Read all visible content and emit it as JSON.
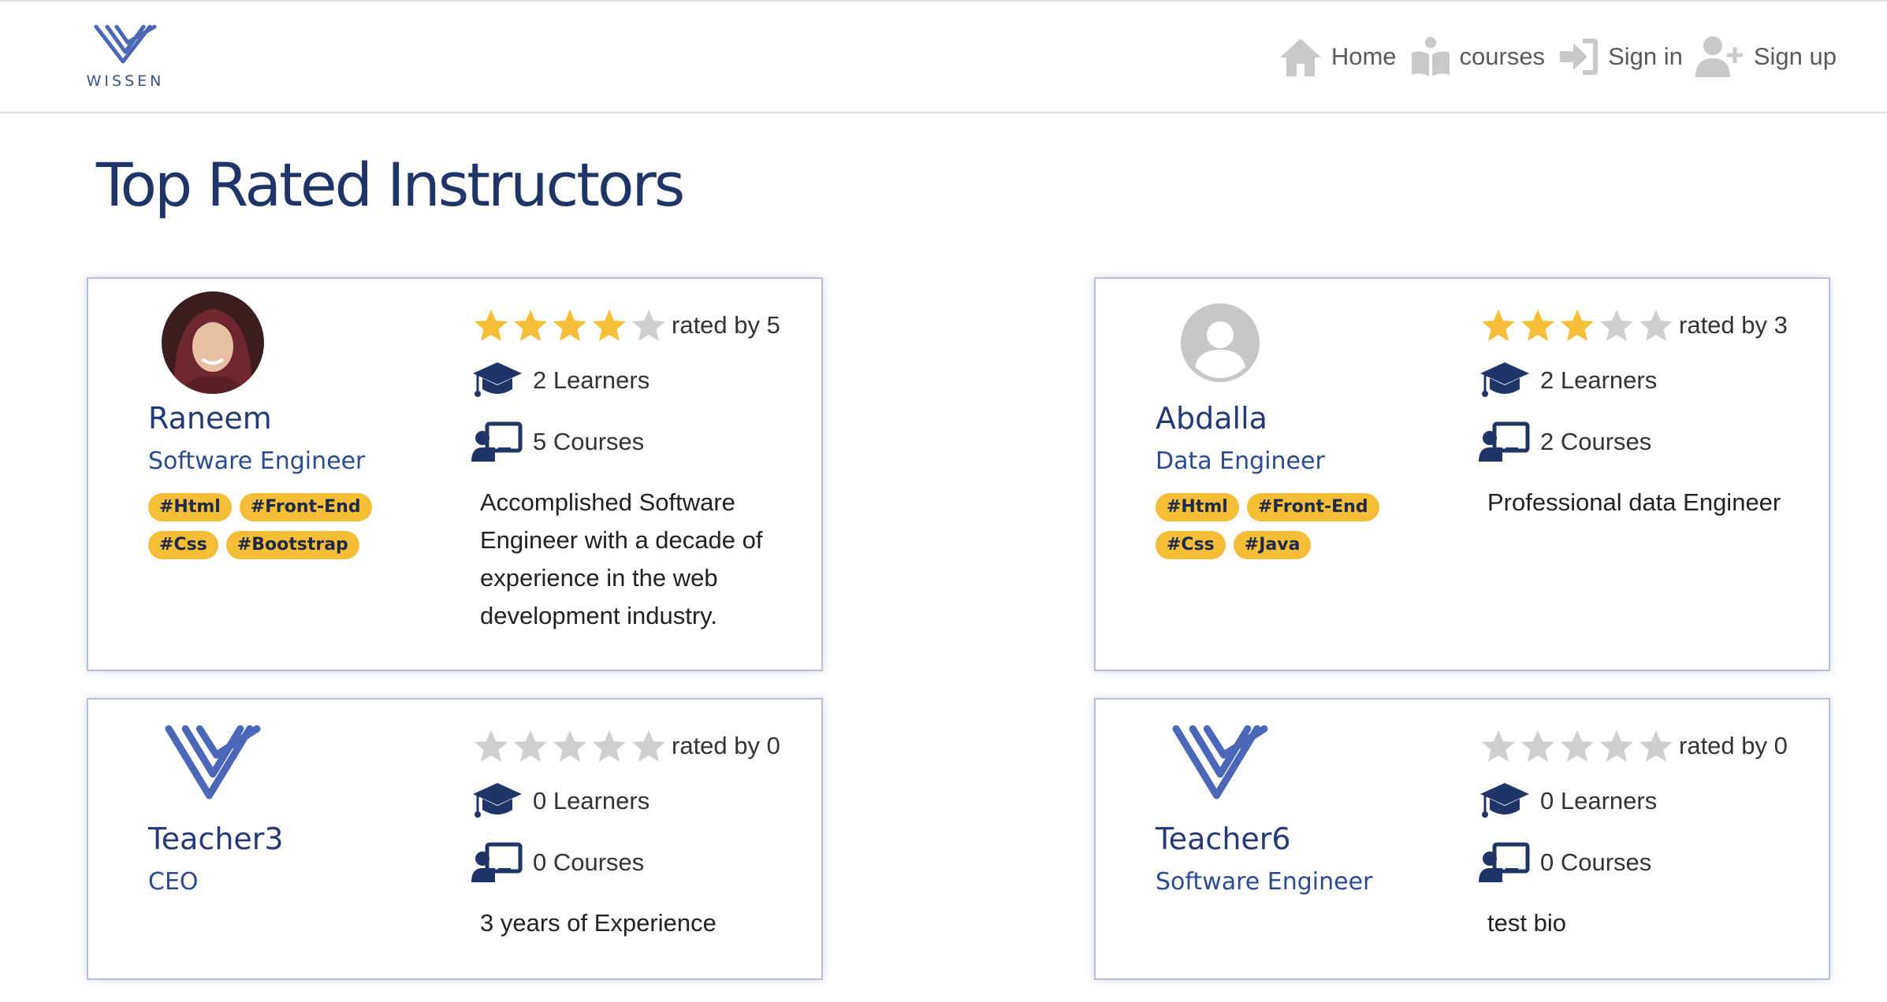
{
  "brand": {
    "name": "WISSEN"
  },
  "nav": [
    {
      "label": "Home",
      "icon": "home-icon"
    },
    {
      "label": "courses",
      "icon": "courses-icon"
    },
    {
      "label": "Sign in",
      "icon": "sign-in-icon"
    },
    {
      "label": "Sign up",
      "icon": "sign-up-icon"
    }
  ],
  "page": {
    "title": "Top Rated Instructors"
  },
  "colors": {
    "navy": "#1f3468",
    "star": "#f6bd36",
    "star_empty": "#cfcfcf",
    "tag": "#f6bd36"
  },
  "instructors": [
    {
      "name": "Raneem",
      "title": "Software Engineer",
      "avatar": "photo",
      "rating": 4,
      "rated_by": "rated by 5",
      "learners": "2 Learners",
      "courses": "5 Courses",
      "bio": "Accomplished Software Engineer with a decade of experience in the web development industry.",
      "tags": [
        "#Html",
        "#Front-End",
        "#Css",
        "#Bootstrap"
      ]
    },
    {
      "name": "Abdalla",
      "title": "Data Engineer",
      "avatar": "placeholder",
      "rating": 3,
      "rated_by": "rated by 3",
      "learners": "2 Learners",
      "courses": "2 Courses",
      "bio": "Professional data Engineer",
      "tags": [
        "#Html",
        "#Front-End",
        "#Css",
        "#Java"
      ]
    },
    {
      "name": "Teacher3",
      "title": "CEO",
      "avatar": "logo",
      "rating": 0,
      "rated_by": "rated by 0",
      "learners": "0 Learners",
      "courses": "0 Courses",
      "bio": "3 years of Experience",
      "tags": []
    },
    {
      "name": "Teacher6",
      "title": "Software Engineer",
      "avatar": "logo",
      "rating": 0,
      "rated_by": "rated by 0",
      "learners": "0 Learners",
      "courses": "0 Courses",
      "bio": "test bio",
      "tags": []
    }
  ]
}
